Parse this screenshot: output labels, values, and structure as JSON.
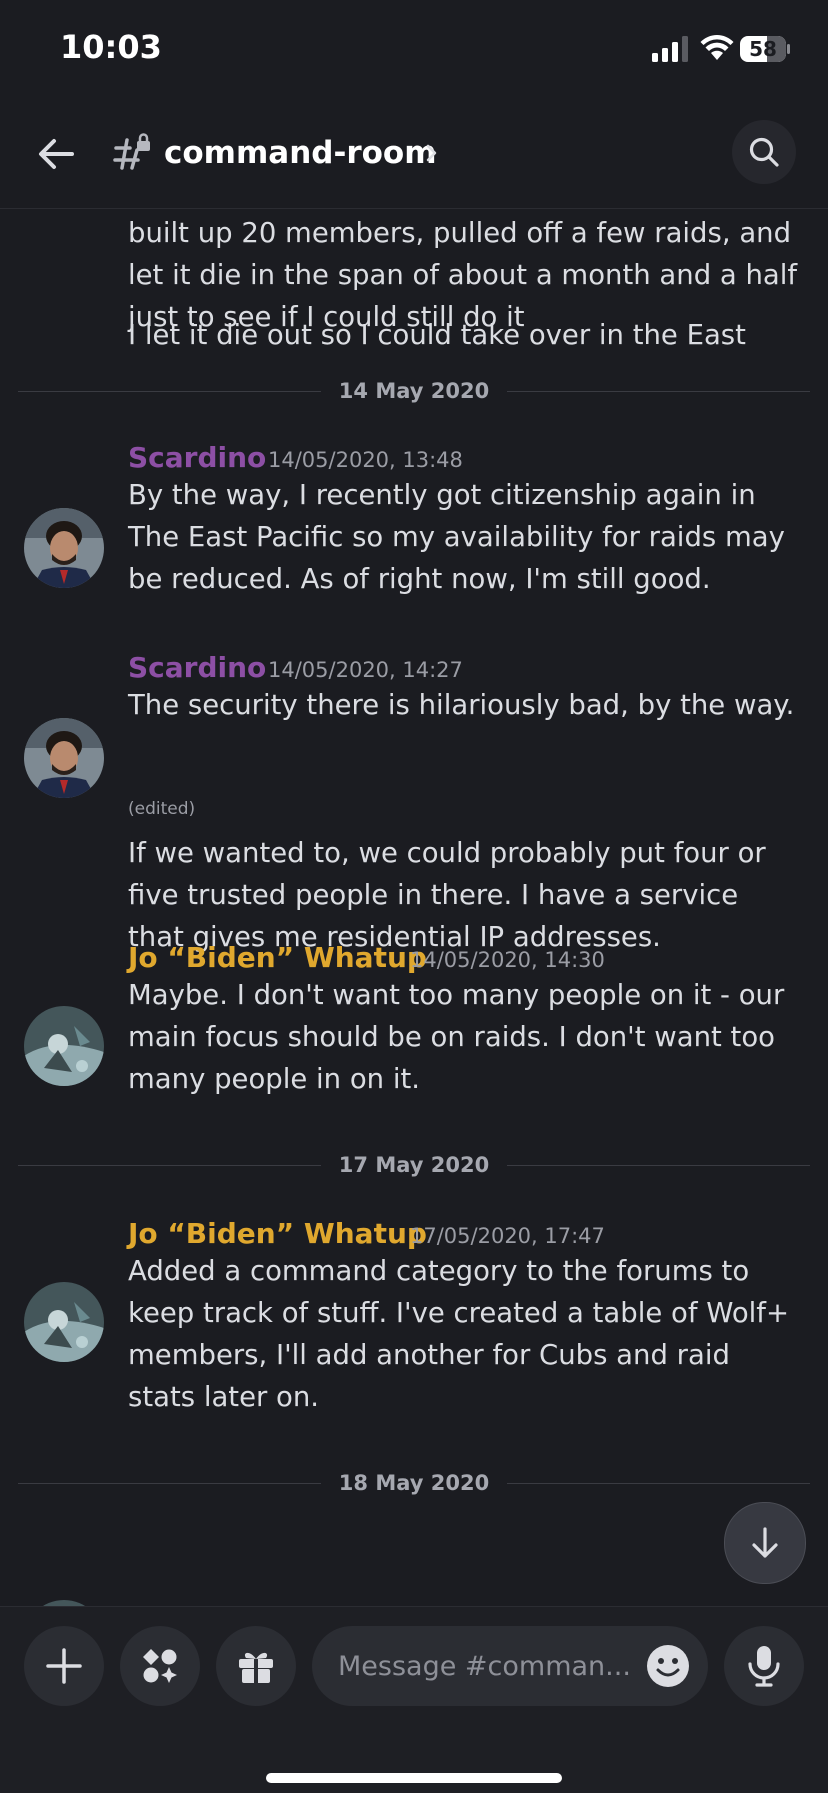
{
  "status_bar": {
    "time": "10:03",
    "battery": "58"
  },
  "header": {
    "channel_name": "command-room"
  },
  "messages": {
    "continued": {
      "lines": [
        "built up 20 members, pulled off a few raids, and let it die in the span of about a month and a half just to see if I could still do it",
        "I let it die out so I could take over in the East"
      ]
    },
    "dividers": [
      "14 May 2020",
      "17 May 2020",
      "18 May 2020"
    ],
    "items": [
      {
        "author": "Scardino",
        "timestamp": "14/05/2020, 13:48",
        "text": "By the way, I recently got citizenship again in The East Pacific so my availability for raids may be reduced. As of right now, I'm still good."
      },
      {
        "author": "Scardino",
        "timestamp": "14/05/2020, 14:27",
        "text": "The security there is hilariously bad, by the way.",
        "edited_label": "(edited)",
        "followup": "If we wanted to, we could probably put four or five trusted people in there. I have a service that gives me residential IP addresses."
      },
      {
        "author": "Jo “Biden” Whatup",
        "timestamp": "14/05/2020, 14:30",
        "text": "Maybe. I don't want too many people on it - our main focus should be on raids. I don't want too many people in on it."
      },
      {
        "author": "Jo “Biden” Whatup",
        "timestamp": "17/05/2020, 17:47",
        "text": "Added a command category to the forums to keep track of stuff. I've created a table of Wolf+ members, I'll add another for Cubs and raid stats later on."
      }
    ]
  },
  "composer": {
    "placeholder": "Message #comman..."
  },
  "icons": {
    "back": "arrow-left-icon",
    "channel": "hash-lock-icon",
    "search": "search-icon",
    "add": "plus-icon",
    "apps": "apps-icon",
    "gift": "gift-icon",
    "emoji": "emoji-icon",
    "mic": "microphone-icon",
    "scroll": "arrow-down-icon"
  },
  "colors": {
    "background": "#1b1c21",
    "scardino": "#8d4fa5",
    "jo": "#e0a82e"
  }
}
